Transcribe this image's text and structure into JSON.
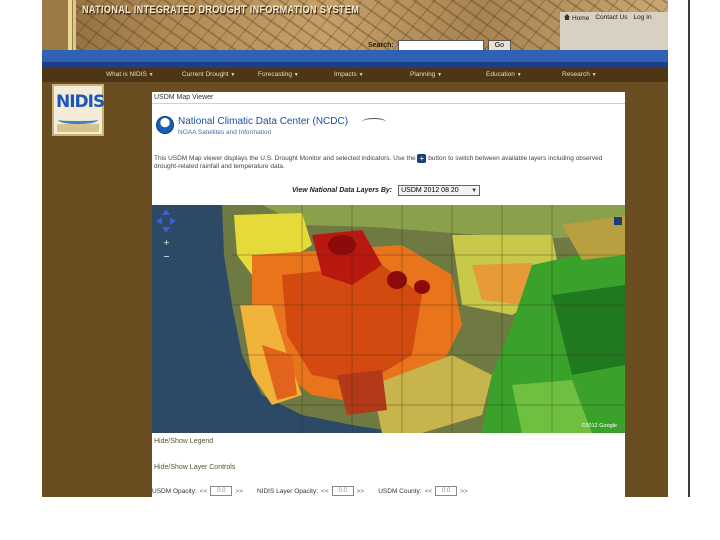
{
  "header": {
    "site_title": "NATIONAL INTEGRATED DROUGHT INFORMATION SYSTEM",
    "search_label": "Search:",
    "search_value": "",
    "go_label": "Go",
    "links": [
      "Home",
      "Contact Us",
      "Log In"
    ]
  },
  "nav": [
    "What is NIDIS",
    "Current Drought",
    "Forecasting",
    "Impacts",
    "Planning",
    "Education",
    "Research"
  ],
  "logo": {
    "text": "NIDIS"
  },
  "viewer": {
    "title": "USDM Map Viewer",
    "org_title": "National Climatic Data Center (NCDC)",
    "org_subtitle": "NOAA Satellites and Information",
    "description": "This USDM Map viewer displays the U.S. Drought Monitor and selected indicators. Use the",
    "description_tail": "button to switch between available layers including observed drought-related rainfall and temperature data.",
    "layer_label": "View National Data Layers By:",
    "layer_value": "USDM 2012 08 20",
    "legend_link": "Hide/Show Legend",
    "options_link": "Hide/Show Layer Controls",
    "opacity": [
      {
        "label": "USDM Opacity:",
        "value": "0.0"
      },
      {
        "label": "NIDIS Layer Opacity:",
        "value": "0.0"
      },
      {
        "label": "USDM County:",
        "value": "0.0"
      }
    ],
    "map_credit": "©2012 Google"
  },
  "colors": {
    "nav_bg": "#4d3515",
    "blue_bar": "#2f62b5",
    "ncdc_blue": "#1b4f9c",
    "drought_d4": "#730000",
    "drought_d3": "#e60000",
    "drought_d2": "#ffaa00",
    "drought_d1": "#fcd37f",
    "drought_d0": "#ffff00",
    "wet": "#2ea12e"
  },
  "icons": [
    "home-icon",
    "plus-icon",
    "chevron-down-icon",
    "pan-up-icon",
    "pan-left-icon",
    "pan-right-icon",
    "pan-down-icon",
    "zoom-in-icon",
    "zoom-out-icon",
    "noaa-logo-icon"
  ]
}
